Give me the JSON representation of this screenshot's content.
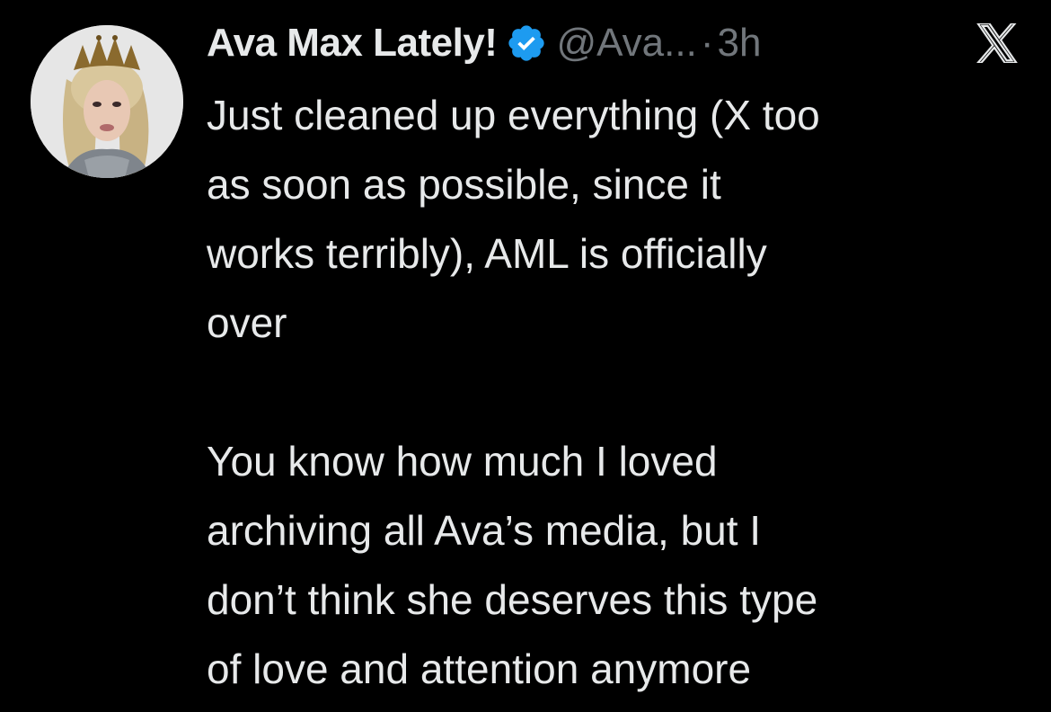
{
  "tweet": {
    "author": {
      "display_name": "Ava Max Lately!",
      "handle": "@Ava...",
      "verified": true,
      "avatar_icon": "profile-photo"
    },
    "separator": "·",
    "time": "3h",
    "platform_icon": "x-logo-icon",
    "paragraphs": [
      [
        "Just cleaned up everything (X too",
        "as soon as possible, since it",
        "works terribly), AML is officially",
        "over"
      ],
      [
        "You know how much I loved",
        "archiving all Ava’s media, but I",
        "don’t think she deserves this type",
        "of love and attention anymore"
      ]
    ]
  },
  "colors": {
    "background": "#000000",
    "primary_text": "#e7e9ea",
    "secondary_text": "#71767b",
    "verified_badge": "#1d9bf0"
  }
}
